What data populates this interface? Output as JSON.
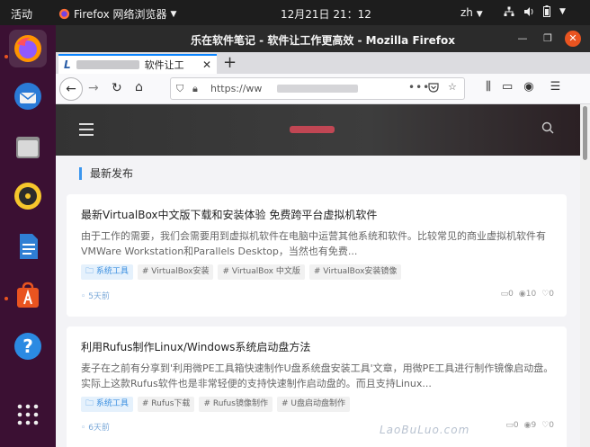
{
  "topbar": {
    "activities": "活动",
    "app_name": "Firefox 网络浏览器",
    "clock": "12月21日 21：12",
    "lang": "zh"
  },
  "window": {
    "title": "乐在软件笔记 - 软件让工作更高效 - Mozilla Firefox"
  },
  "tab": {
    "label": "软件让工"
  },
  "urlbar": {
    "url": "https://ww"
  },
  "page": {
    "section_title": "最新发布",
    "watermark": "LaoBuLuo.com",
    "posts": [
      {
        "title": "最新VirtualBox中文版下载和安装体验 免费跨平台虚拟机软件",
        "excerpt": "由于工作的需要，我们会需要用到虚拟机软件在电脑中运营其他系统和软件。比较常见的商业虚拟机软件有VMWare Workstation和Parallels Desktop，当然也有免费...",
        "category": "系统工具",
        "tags": [
          "# VirtualBox安装",
          "# VirtualBox 中文版",
          "# VirtualBox安装镜像"
        ],
        "time": "5天前",
        "comments": "0",
        "views": "10",
        "likes": "0"
      },
      {
        "title": "利用Rufus制作Linux/Windows系统启动盘方法",
        "excerpt": "麦子在之前有分享到'利用微PE工具箱快速制作U盘系统盘安装工具'文章，用微PE工具进行制作镜像启动盘。实际上这款Rufus软件也是非常轻便的支持快速制作启动盘的。而且支持Linux...",
        "category": "系统工具",
        "tags": [
          "# Rufus下载",
          "# Rufus镜像制作",
          "# U盘启动盘制作"
        ],
        "time": "6天前",
        "comments": "0",
        "views": "9",
        "likes": "0"
      }
    ]
  },
  "colors": {
    "accent": "#e95420",
    "link_blue": "#3b96ee",
    "dock_bg": "#3b1033"
  }
}
